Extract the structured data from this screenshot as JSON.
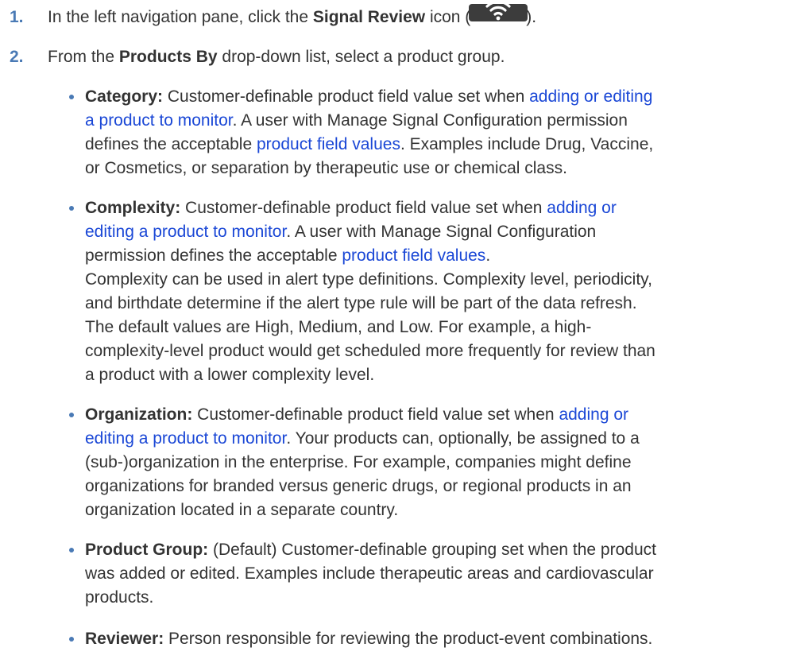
{
  "steps": [
    {
      "number": "1.",
      "before": "In the left navigation pane, click the ",
      "bold": "Signal Review",
      "after_bold": " icon (",
      "icon": "wifi-signal-icon",
      "closing": ")."
    },
    {
      "number": "2.",
      "before": "From the ",
      "bold": "Products By",
      "after_bold": " drop-down list, select a product group."
    }
  ],
  "bullets": {
    "category": {
      "label": "Category:",
      "line1": " Customer-definable product field value set when ",
      "link1_part1": "adding or editing",
      "link1_part2": "a product to monitor",
      "line2_after": ". A user with Manage Signal Configuration permission",
      "line3_before": "defines the acceptable ",
      "link2": "product field values",
      "line3_after": ". Examples include Drug, Vaccine,",
      "line4": "or Cosmetics, or separation by therapeutic use or chemical class."
    },
    "complexity": {
      "label": "Complexity:",
      "line1": " Customer-definable product field value set when ",
      "link1_part1": "adding or",
      "link1_part2": "editing a product to monitor",
      "line2_after": ". A user with Manage Signal Configuration",
      "line3_before": "permission defines the acceptable ",
      "link2": "product field values",
      "line3_after": ".",
      "line4": "Complexity can be used in alert type definitions. Complexity level, periodicity,",
      "line5": "and birthdate determine if the alert type rule will be part of the data refresh.",
      "line6": "The default values are High, Medium, and Low. For example, a high-",
      "line7": "complexity-level product would get scheduled more frequently for review than",
      "line8": "a product with a lower complexity level."
    },
    "organization": {
      "label": "Organization:",
      "line1": " Customer-definable product field value set when ",
      "link1_part1": "adding or",
      "link1_part2": "editing a product to monitor",
      "line2_after": ". Your products can, optionally, be assigned to a",
      "line3": "(sub-)organization in the enterprise. For example, companies might define",
      "line4": "organizations for branded versus generic drugs, or regional products in an",
      "line5": "organization located in a separate country."
    },
    "product_group": {
      "label": "Product Group:",
      "line1": " (Default) Customer-definable grouping set when the product",
      "line2": "was added or edited. Examples include therapeutic areas and cardiovascular",
      "line3": "products."
    },
    "reviewer": {
      "label": "Reviewer:",
      "line1": " Person responsible for reviewing the product-event combinations."
    }
  },
  "colors": {
    "text": "#333333",
    "link": "#1a47d6",
    "accent": "#4a7ab5",
    "icon_bg": "#3c3c3c"
  }
}
